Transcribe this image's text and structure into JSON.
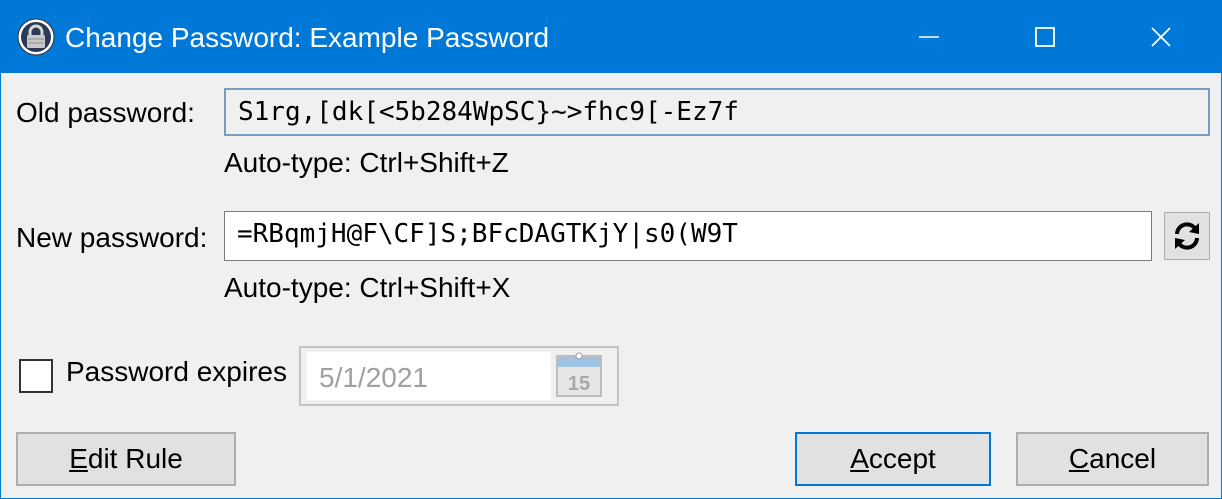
{
  "window": {
    "title": "Change Password: Example Password",
    "accent_color": "#0078d7",
    "controls": {
      "minimize_icon": "minimize-icon",
      "maximize_icon": "maximize-icon",
      "close_icon": "close-icon"
    }
  },
  "form": {
    "old_password_label": "Old password:",
    "old_password_value": "S1rg,[dk[<5b284WpSC}~>fhc9[-Ez7f",
    "old_autotype": "Auto-type: Ctrl+Shift+Z",
    "new_password_label": "New password:",
    "new_password_value": "=RBqmjH@F\\CF]S;BFcDAGTKjY|s0(W9T",
    "new_autotype": "Auto-type: Ctrl+Shift+X",
    "generate_icon": "refresh-icon",
    "expires_label": "Password expires",
    "expires_checked": false,
    "expires_date": "5/1/2021",
    "calendar_day": "15"
  },
  "buttons": {
    "edit_rule": {
      "mnemonic": "E",
      "rest": "dit Rule"
    },
    "accept": {
      "mnemonic": "A",
      "rest": "ccept"
    },
    "cancel": {
      "mnemonic": "C",
      "rest": "ancel"
    }
  }
}
